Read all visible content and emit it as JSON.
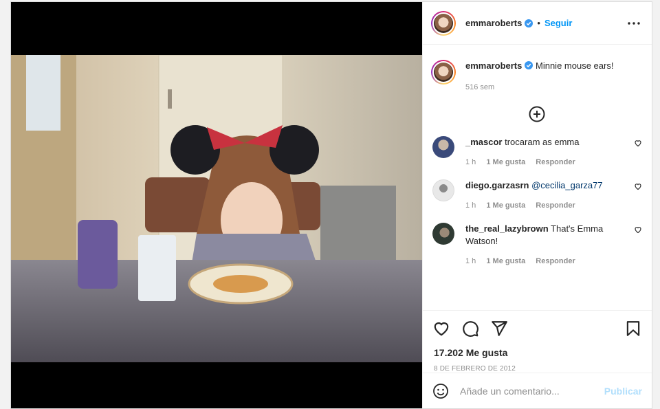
{
  "post": {
    "author": "emmaroberts",
    "follow_label": "Seguir",
    "separator": "•",
    "caption_text": "Minnie mouse ears!",
    "caption_age": "516 sem",
    "likes_text": "17.202 Me gusta",
    "date_text": "8 DE FEBRERO DE 2012"
  },
  "comments": [
    {
      "user": "_mascor",
      "text": "trocaram as emma",
      "mention": "",
      "age": "1 h",
      "likes": "1 Me gusta",
      "reply": "Responder"
    },
    {
      "user": "diego.garzasrn",
      "text": "",
      "mention": "@cecilia_garza77",
      "age": "1 h",
      "likes": "1 Me gusta",
      "reply": "Responder"
    },
    {
      "user": "the_real_lazybrown",
      "text": "That's Emma Watson!",
      "mention": "",
      "age": "1 h",
      "likes": "1 Me gusta",
      "reply": "Responder"
    }
  ],
  "composer": {
    "placeholder": "Añade un comentario...",
    "publish_label": "Publicar"
  },
  "icons": [
    "verified-badge-icon",
    "more-options-icon",
    "load-more-comments-icon",
    "heart-icon",
    "comment-icon",
    "share-icon",
    "bookmark-icon",
    "emoji-icon"
  ],
  "colors": {
    "accent": "#0095f6",
    "publish_disabled": "#b2dffc",
    "verified": "#3897f0"
  }
}
